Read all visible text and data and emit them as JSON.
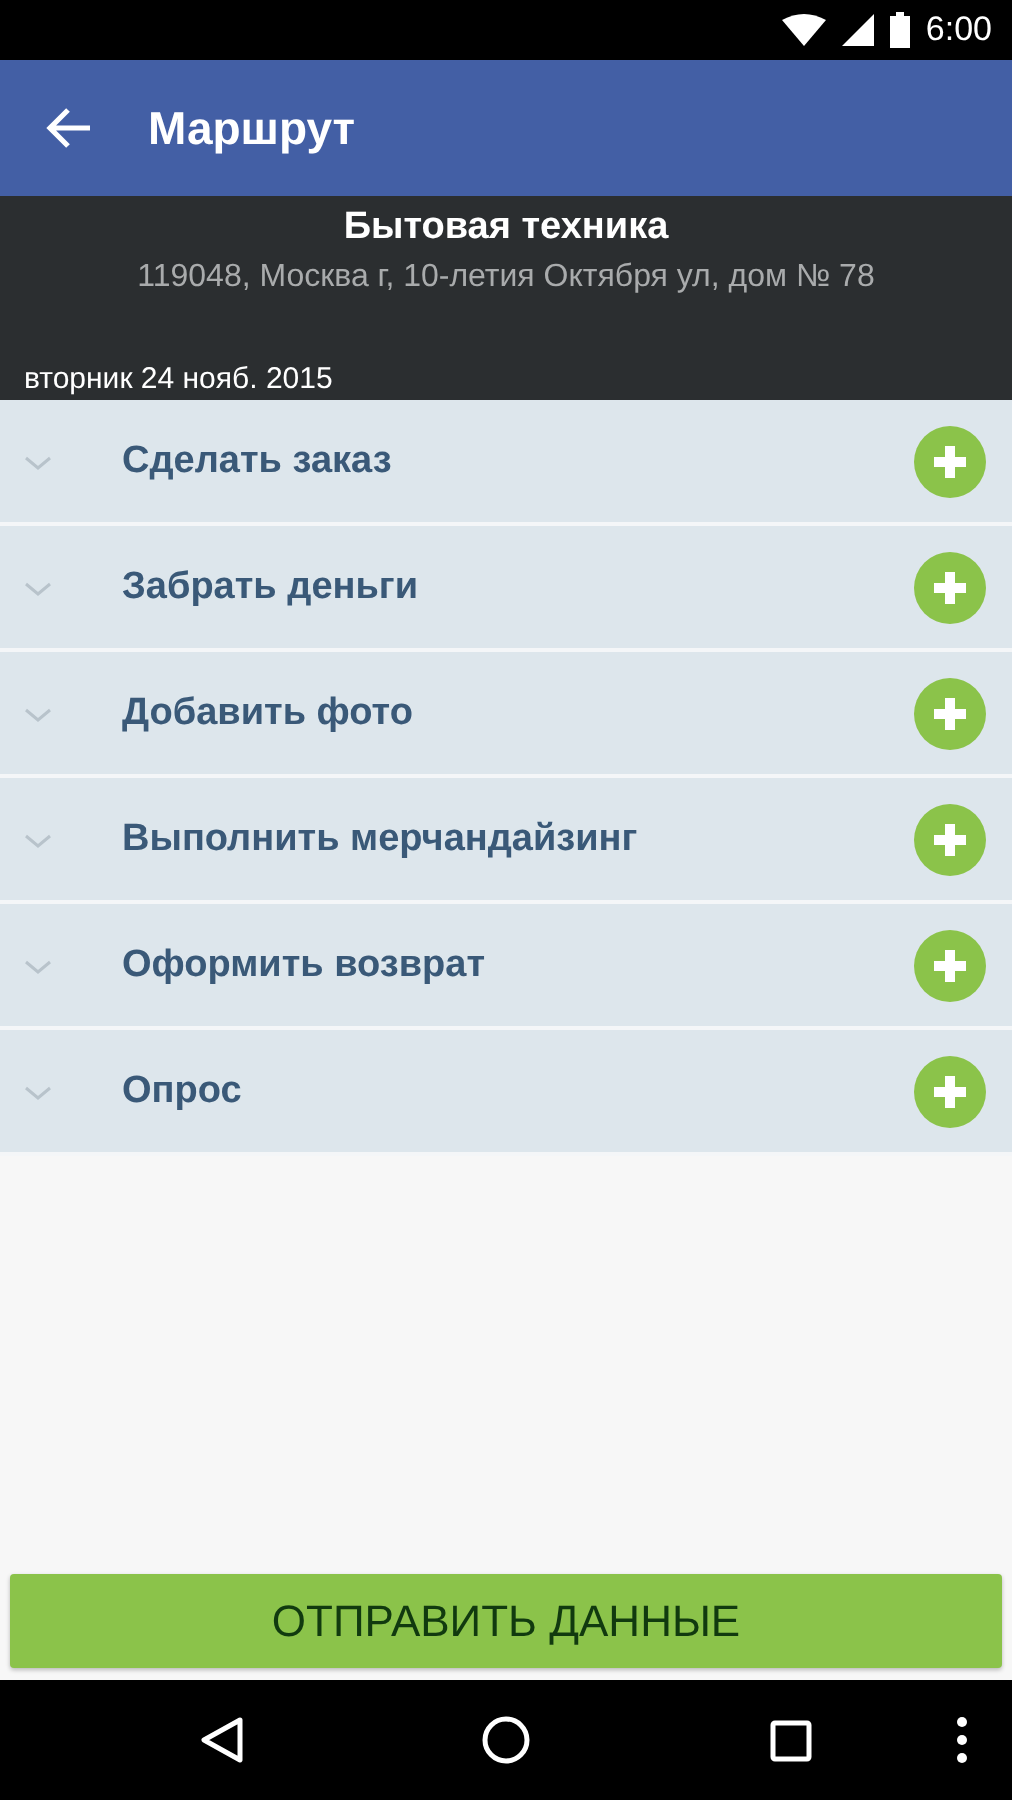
{
  "status_bar": {
    "time": "6:00"
  },
  "app_bar": {
    "title": "Маршрут"
  },
  "header": {
    "name": "Бытовая техника",
    "address": "119048, Москва г, 10-летия Октября ул, дом № 78",
    "date": "вторник 24 нояб. 2015"
  },
  "actions": [
    {
      "label": "Сделать заказ",
      "expanded": false
    },
    {
      "label": "Забрать деньги",
      "expanded": false
    },
    {
      "label": "Добавить фото",
      "expanded": false
    },
    {
      "label": "Выполнить мерчандайзинг",
      "expanded": false
    },
    {
      "label": "Оформить возврат",
      "expanded": false
    },
    {
      "label": "Опрос",
      "expanded": false
    }
  ],
  "send_button": {
    "label": "ОТПРАВИТЬ ДАННЫЕ"
  }
}
